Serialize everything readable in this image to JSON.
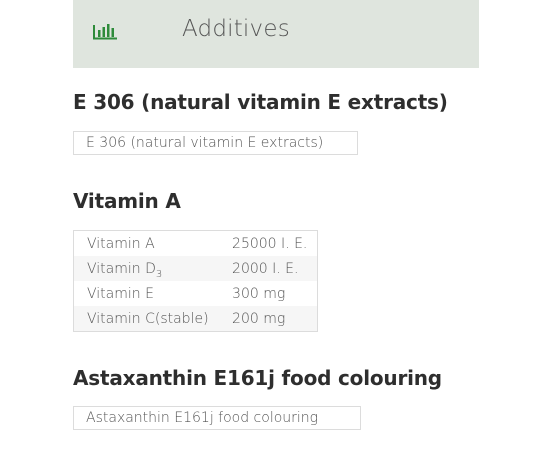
{
  "header": {
    "title": "Additives",
    "icon": "bar-chart-icon",
    "icon_color": "#2e8b3a",
    "background": "#dfe5de"
  },
  "sections": [
    {
      "heading": "E 306 (natural vitamin E extracts)",
      "box_text": "E 306 (natural vitamin E extracts)"
    },
    {
      "heading": "Vitamin A",
      "table": [
        {
          "name": "Vitamin A",
          "name_sub": "",
          "value": "25000 I. E."
        },
        {
          "name": "Vitamin D",
          "name_sub": "3",
          "value": "2000 I. E."
        },
        {
          "name": "Vitamin E",
          "name_sub": "",
          "value": "300 mg"
        },
        {
          "name": "Vitamin C(stable)",
          "name_sub": "",
          "value": "200 mg"
        }
      ]
    },
    {
      "heading": "Astaxanthin E161j food colouring",
      "box_text": "Astaxanthin E161j food colouring"
    }
  ]
}
